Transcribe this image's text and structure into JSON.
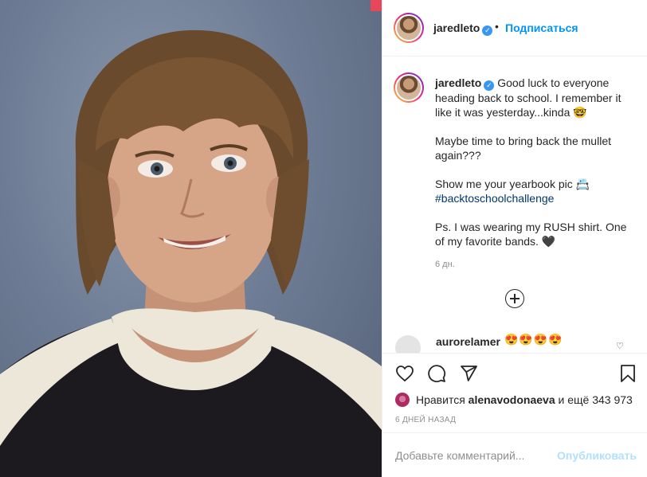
{
  "header": {
    "username": "jaredleto",
    "separator": "•",
    "follow_label": "Подписаться"
  },
  "caption": {
    "username": "jaredleto",
    "line1": "Good luck to everyone heading back to school. I remember it like it was yesterday...kinda 🤓",
    "line2": "Maybe time to bring back the mullet again???",
    "line3": "Show me your yearbook pic 📇",
    "hashtag": "#backtoschoolchallenge",
    "line4": "Ps. I was wearing my RUSH shirt. One of my favorite bands. 🖤",
    "time": "6 дн."
  },
  "comment": {
    "username": "aurorelamer",
    "text": "😍😍😍😍"
  },
  "likes": {
    "prefix": "Нравится",
    "user": "alenavodonaeva",
    "suffix": "и ещё 343 973"
  },
  "date_label": "6 ДНЕЙ НАЗАД",
  "add_comment": {
    "placeholder": "Добавьте комментарий...",
    "publish_label": "Опубликовать"
  },
  "colors": {
    "accent": "#0095f6",
    "verified": "#3897f0",
    "publish_disabled": "#b2dffc"
  }
}
